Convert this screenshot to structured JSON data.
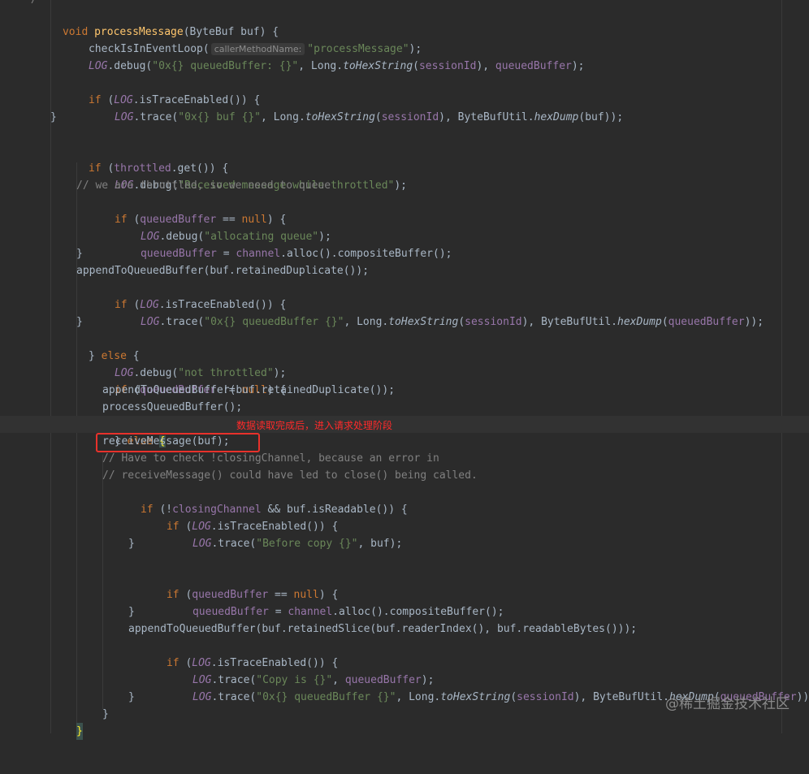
{
  "annotation_text": "数据读取完成后，进入请求处理阶段",
  "watermark": "@稀土掘金技术社区",
  "param_hint": "callerMethodName:",
  "code": {
    "top_comment": "*/",
    "l1": {
      "void": "void",
      "name": "processMessage",
      "sig": "(ByteBuf buf) {"
    },
    "l2": {
      "call": "checkIsInEventLoop(",
      "arg": "\"processMessage\"",
      "end": ");"
    },
    "l3": {
      "log": "LOG",
      "m": ".debug(",
      "s": "\"0x{} queuedBuffer: {}\"",
      "a": ", Long.",
      "hx": "toHexString",
      "b": "(",
      "f1": "sessionId",
      "c": "), ",
      "f2": "queuedBuffer",
      "d": ");"
    },
    "l5": {
      "if": "if",
      "a": " (",
      "log": "LOG",
      "m": ".isTraceEnabled()) {"
    },
    "l6": {
      "log": "LOG",
      "m": ".trace(",
      "s": "\"0x{} buf {}\"",
      "a": ", Long.",
      "hx": "toHexString",
      "b": "(",
      "f1": "sessionId",
      "c": "), ByteBufUtil.",
      "hd": "hexDump",
      "d": "(buf));"
    },
    "close": "}",
    "l9": {
      "if": "if",
      "a": " (",
      "f": "throttled",
      "b": ".get()) {"
    },
    "l10": {
      "log": "LOG",
      "m": ".debug(",
      "s": "\"Received message while throttled\"",
      "d": ");"
    },
    "l11": "// we are throttled, so we need to queue",
    "l12": {
      "if": "if",
      "a": " (",
      "f": "queuedBuffer",
      "b": " == ",
      "null": "null",
      "c": ") {"
    },
    "l13": {
      "log": "LOG",
      "m": ".debug(",
      "s": "\"allocating queue\"",
      "d": ");"
    },
    "l14": {
      "f1": "queuedBuffer",
      "a": " = ",
      "f2": "channel",
      "b": ".alloc().compositeBuffer();"
    },
    "l16": "appendToQueuedBuffer(buf.retainedDuplicate());",
    "l17": {
      "if": "if",
      "a": " (",
      "log": "LOG",
      "m": ".isTraceEnabled()) {"
    },
    "l18": {
      "log": "LOG",
      "m": ".trace(",
      "s": "\"0x{} queuedBuffer {}\"",
      "a": ", Long.",
      "hx": "toHexString",
      "b": "(",
      "f1": "sessionId",
      "c": "), ByteBufUtil.",
      "hd": "hexDump",
      "e": "(",
      "f2": "queuedBuffer",
      "d": "));"
    },
    "l20": {
      "a": "} ",
      "else": "else",
      "b": " {"
    },
    "l21": {
      "log": "LOG",
      "m": ".debug(",
      "s": "\"not throttled\"",
      "d": ");"
    },
    "l22": {
      "if": "if",
      "a": " (",
      "f": "queuedBuffer",
      "b": " != ",
      "null": "null",
      "c": ") {"
    },
    "l23": "appendToQueuedBuffer(buf.retainedDuplicate());",
    "l24": "processQueuedBuffer();",
    "l25": {
      "a": "} ",
      "else": "else",
      "b": " ",
      "brace": "{"
    },
    "l26": "receiveMessage(buf);",
    "l27": "// Have to check !closingChannel, because an error in",
    "l28": "// receiveMessage() could have led to close() being called.",
    "l29": {
      "if": "if",
      "a": " (!",
      "f": "closingChannel",
      "b": " && buf.isReadable()) {"
    },
    "l30": {
      "if": "if",
      "a": " (",
      "log": "LOG",
      "m": ".isTraceEnabled()) {"
    },
    "l31": {
      "log": "LOG",
      "m": ".trace(",
      "s": "\"Before copy {}\"",
      "d": ", buf);"
    },
    "l34": {
      "if": "if",
      "a": " (",
      "f": "queuedBuffer",
      "b": " == ",
      "null": "null",
      "c": ") {"
    },
    "l35": {
      "f1": "queuedBuffer",
      "a": " = ",
      "f2": "channel",
      "b": ".alloc().compositeBuffer();"
    },
    "l37": "appendToQueuedBuffer(buf.retainedSlice(buf.readerIndex(), buf.readableBytes()));",
    "l38": {
      "if": "if",
      "a": " (",
      "log": "LOG",
      "m": ".isTraceEnabled()) {"
    },
    "l39": {
      "log": "LOG",
      "m": ".trace(",
      "s": "\"Copy is {}\"",
      "a": ", ",
      "f": "queuedBuffer",
      "d": ");"
    },
    "l40": {
      "log": "LOG",
      "m": ".trace(",
      "s": "\"0x{} queuedBuffer {}\"",
      "a": ", Long.",
      "hx": "toHexString",
      "b": "(",
      "f1": "sessionId",
      "c": "), ByteBufUtil.",
      "hd": "hexDump",
      "e": "(",
      "f2": "queuedBuffer",
      "d": "));"
    }
  }
}
